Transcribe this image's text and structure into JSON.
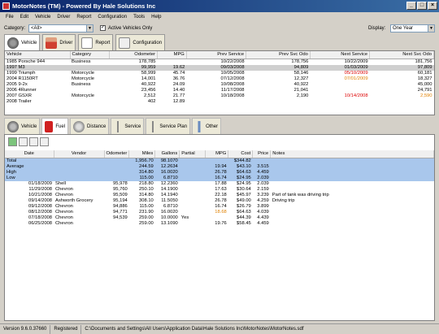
{
  "window": {
    "title": "MotorNotes (TM) - Powered By Hale Solutions Inc"
  },
  "menu": [
    "File",
    "Edit",
    "Vehicle",
    "Driver",
    "Report",
    "Configuration",
    "Tools",
    "Help"
  ],
  "filter": {
    "category_label": "Category:",
    "category_value": "<All>",
    "active_label": "Active Vehicles Only",
    "display_label": "Display:",
    "display_value": "One Year"
  },
  "main_tabs": [
    {
      "label": "Vehicle",
      "icon": "car-icon"
    },
    {
      "label": "Driver",
      "icon": "person-icon"
    },
    {
      "label": "Report",
      "icon": "report-icon"
    },
    {
      "label": "Configuration",
      "icon": "config-icon"
    }
  ],
  "vehicles": {
    "columns": [
      "Vehicle",
      "Category",
      "Odometer",
      "MPG",
      "Prev Service",
      "Prev Svc Odo",
      "Next Service",
      "Next Svc Odo"
    ],
    "rows": [
      [
        "1985 Porsche 944",
        "Business",
        "178,785",
        "",
        "10/22/2008",
        "178,756",
        "10/22/2009",
        "181,756"
      ],
      [
        "1997 M3",
        "",
        "99,959",
        "19.62",
        "09/03/2008",
        "94,809",
        "01/03/2009",
        "97,809"
      ],
      [
        "1999 Triumph",
        "Motorcycle",
        "58,999",
        "45.74",
        "10/05/2008",
        "58,146",
        "05/10/2009",
        "60,181"
      ],
      [
        "2004 R1150RT",
        "Motorcycle",
        "14,001",
        "36.76",
        "07/12/2008",
        "12,327",
        "07/01/2009",
        "18,327"
      ],
      [
        "2005 9-2x",
        "Business",
        "40,922",
        "24.09",
        "10/08/2008",
        "40,922",
        "",
        "45,000"
      ],
      [
        "2006 4Runner",
        "",
        "23,456",
        "14.40",
        "11/17/2008",
        "21,041",
        "",
        "24,791"
      ],
      [
        "2007 GSXR",
        "Motorcycle",
        "2,512",
        "21.77",
        "10/18/2008",
        "2,190",
        "10/14/2008",
        "2,590"
      ],
      [
        "2008 Trailer",
        "",
        "402",
        "12.89",
        "",
        "",
        "",
        ""
      ]
    ]
  },
  "sub_tabs": [
    {
      "label": "Vehicle",
      "icon": "wheel-icon"
    },
    {
      "label": "Fuel",
      "icon": "fuel-icon"
    },
    {
      "label": "Distance",
      "icon": "distance-icon"
    },
    {
      "label": "Service",
      "icon": "wrench-icon"
    },
    {
      "label": "Service Plan",
      "icon": "wrench-icon"
    },
    {
      "label": "Other",
      "icon": "paperclip-icon"
    }
  ],
  "toolbar_icons": [
    "add-icon",
    "edit-icon",
    "copy-icon",
    "delete-icon"
  ],
  "fuel": {
    "columns": [
      "Date",
      "Vendor",
      "Odometer",
      "Miles",
      "Gallons",
      "Partial",
      "MPG",
      "Cost",
      "Price",
      "Notes"
    ],
    "stats": [
      [
        "Total",
        "",
        "",
        "1,956.70",
        "98.1070",
        "",
        "",
        "$344.82",
        "",
        ""
      ],
      [
        "Average",
        "",
        "",
        "244.59",
        "12.2634",
        "",
        "19.94",
        "$43.10",
        "3.515",
        ""
      ],
      [
        "High",
        "",
        "",
        "314.80",
        "16.0020",
        "",
        "26.78",
        "$64.63",
        "4.459",
        ""
      ],
      [
        "Low",
        "",
        "",
        "115.00",
        "6.8710",
        "",
        "16.74",
        "$24.95",
        "2.039",
        ""
      ]
    ],
    "rows": [
      [
        "01/18/2009",
        "Shell",
        "95,978",
        "218.80",
        "12.2360",
        "",
        "17.88",
        "$24.95",
        "2.039",
        ""
      ],
      [
        "11/29/2008",
        "Chevron",
        "95,760",
        "250.10",
        "14.1900",
        "",
        "17.63",
        "$30.64",
        "2.159",
        ""
      ],
      [
        "10/21/2008",
        "Chevron",
        "95,509",
        "314.80",
        "14.1940",
        "",
        "22.18",
        "$45.97",
        "3.239",
        "Part of tank was driving trip"
      ],
      [
        "09/14/2008",
        "Ashworth Grocery",
        "95,194",
        "308.10",
        "11.5050",
        "",
        "26.78",
        "$49.00",
        "4.259",
        "Driving trip"
      ],
      [
        "09/12/2008",
        "Chevron",
        "94,886",
        "115.00",
        "6.8710",
        "",
        "16.74",
        "$26.79",
        "3.899",
        ""
      ],
      [
        "08/12/2008",
        "Chevron",
        "94,771",
        "231.90",
        "16.0020",
        "",
        "18.68",
        "$64.63",
        "4.039",
        ""
      ],
      [
        "07/18/2008",
        "Chevron",
        "94,539",
        "259.00",
        "10.0000",
        "Yes",
        "",
        "$44.39",
        "4.439",
        ""
      ],
      [
        "06/25/2008",
        "Chevron",
        "",
        "259.00",
        "13.1090",
        "",
        "19.76",
        "$58.45",
        "4.459",
        ""
      ]
    ]
  },
  "status": {
    "version": "Version 9.6.0.37660",
    "reg": "Registered",
    "path": "C:\\Documents and Settings\\All Users\\Application Data\\Hale Solutions Inc\\MotorNotes\\MotorNotes.sdf"
  }
}
